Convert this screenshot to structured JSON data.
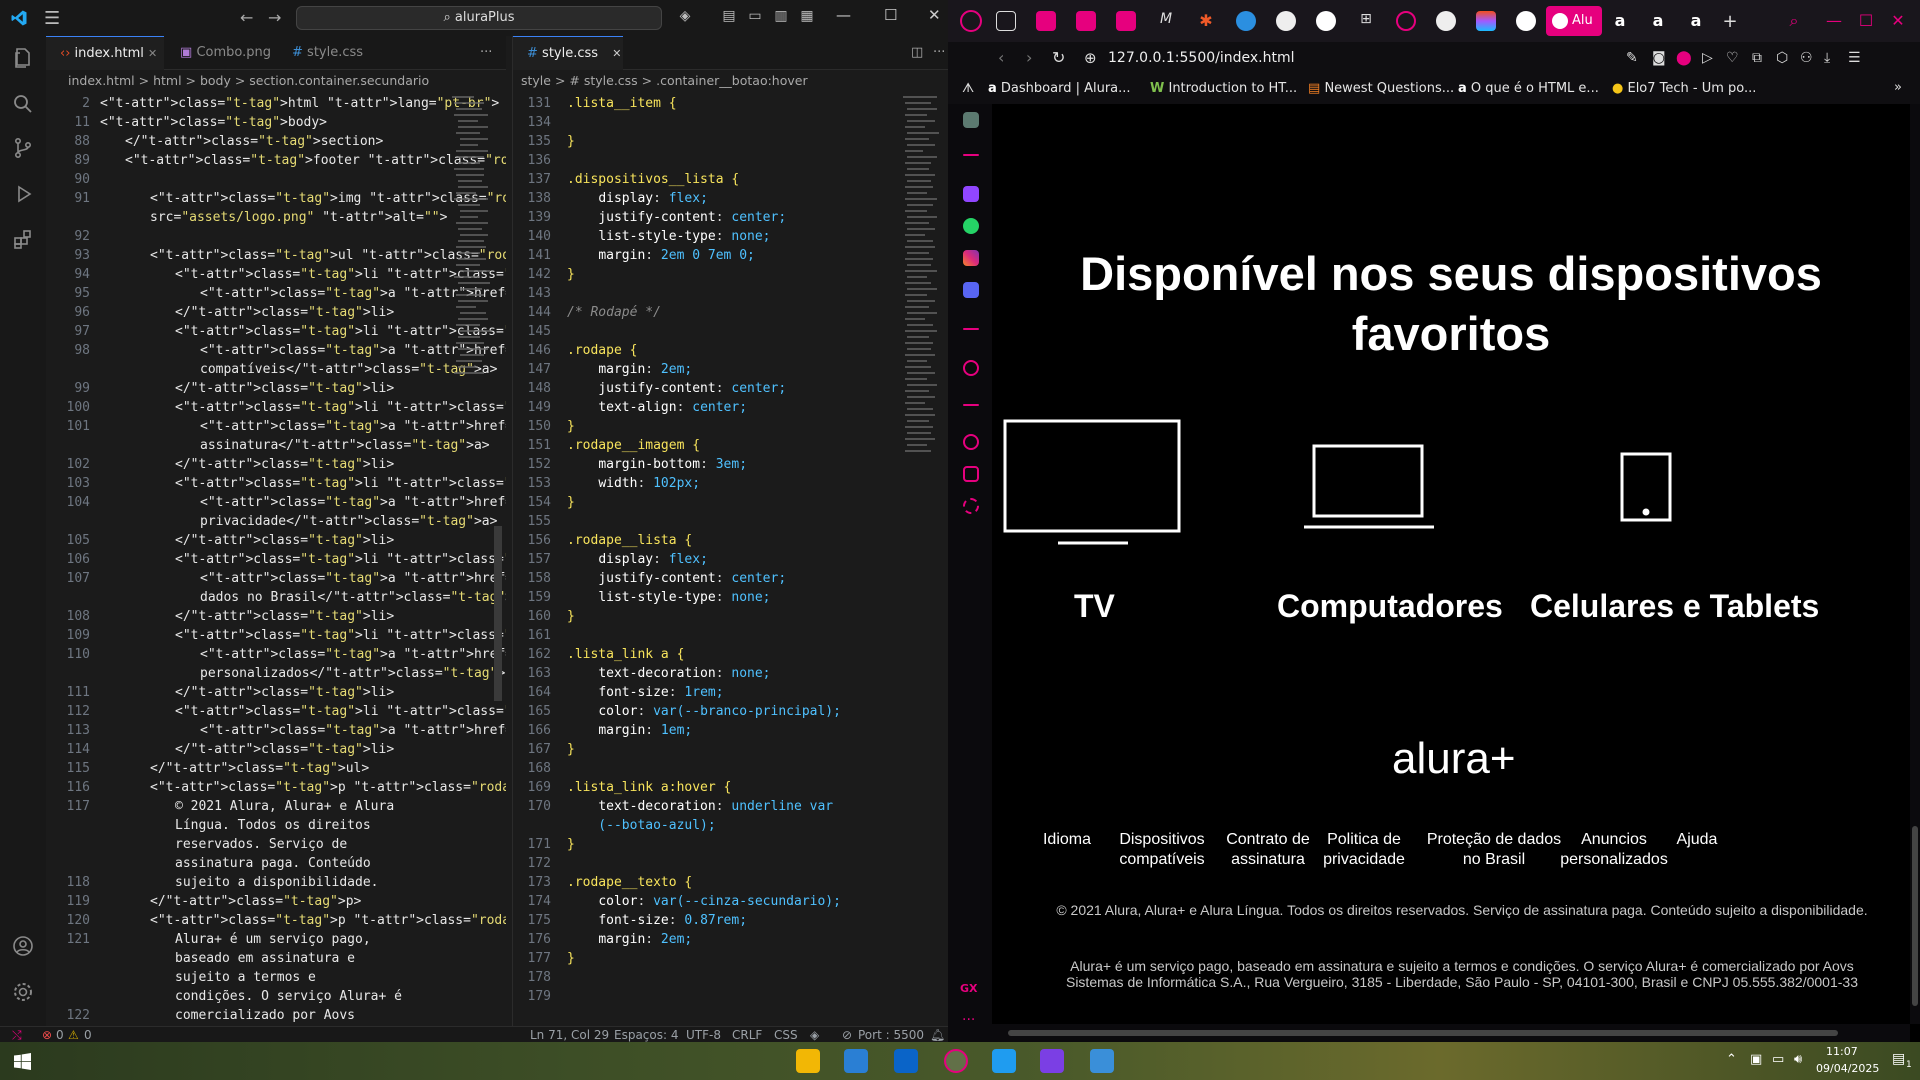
{
  "vscode": {
    "command_center": "aluraPlus",
    "tabs": [
      "index.html",
      "Combo.png",
      "style.css"
    ],
    "right_tab": "style.css",
    "left_crumbs": "index.html  >  html  >  body  >  section.container.secundario",
    "right_crumbs": "style  >  # style.css  >  .container__botao:hover",
    "status": {
      "errors": "0",
      "warnings": "0",
      "position": "Ln 71, Col 29",
      "spaces": "Espaços: 4",
      "encoding": "UTF-8",
      "eol": "CRLF",
      "language": "CSS",
      "port": "Port : 5500"
    },
    "left_lines": [
      {
        "n": "2",
        "t": "<html lang=\"pt-br\">",
        "i": 0
      },
      {
        "n": "11",
        "t": "<body>",
        "i": 0
      },
      {
        "n": "88",
        "t": "</section>",
        "i": 1
      },
      {
        "n": "89",
        "t": "<footer class=\"rodape\">",
        "i": 1
      },
      {
        "n": "90",
        "t": "",
        "i": 0
      },
      {
        "n": "91",
        "t": "<img class=\"rodape__imagem\"",
        "i": 2
      },
      {
        "n": "",
        "t": "src=\"assets/logo.png\" alt=\"\">",
        "i": 2
      },
      {
        "n": "92",
        "t": "",
        "i": 0
      },
      {
        "n": "93",
        "t": "<ul class=\"rodape__lista\">",
        "i": 2
      },
      {
        "n": "94",
        "t": "<li class=\"lista_link\">",
        "i": 3
      },
      {
        "n": "95",
        "t": "<a href=\"#\">Idioma</a>",
        "i": 4
      },
      {
        "n": "96",
        "t": "</li>",
        "i": 3
      },
      {
        "n": "97",
        "t": "<li class=\"lista_link\">",
        "i": 3
      },
      {
        "n": "98",
        "t": "<a href=\"#\">Dispositivos",
        "i": 4
      },
      {
        "n": "",
        "t": "compatíveis</a>",
        "i": 4
      },
      {
        "n": "99",
        "t": "</li>",
        "i": 3
      },
      {
        "n": "100",
        "t": "<li class=\"lista_link\">",
        "i": 3
      },
      {
        "n": "101",
        "t": "<a href=\"#\">Contrato de",
        "i": 4
      },
      {
        "n": "",
        "t": "assinatura</a>",
        "i": 4
      },
      {
        "n": "102",
        "t": "</li>",
        "i": 3
      },
      {
        "n": "103",
        "t": "<li class=\"lista_link\">",
        "i": 3
      },
      {
        "n": "104",
        "t": "<a href=\"#\">Politica de",
        "i": 4
      },
      {
        "n": "",
        "t": "privacidade</a>",
        "i": 4
      },
      {
        "n": "105",
        "t": "</li>",
        "i": 3
      },
      {
        "n": "106",
        "t": "<li class=\"lista_link\">",
        "i": 3
      },
      {
        "n": "107",
        "t": "<a href=\"#\">Proteção de",
        "i": 4
      },
      {
        "n": "",
        "t": "dados no Brasil</a>",
        "i": 4
      },
      {
        "n": "108",
        "t": "</li>",
        "i": 3
      },
      {
        "n": "109",
        "t": "<li class=\"lista_link\">",
        "i": 3
      },
      {
        "n": "110",
        "t": "<a href=\"#\">Anuncios",
        "i": 4
      },
      {
        "n": "",
        "t": "personalizados</a>",
        "i": 4
      },
      {
        "n": "111",
        "t": "</li>",
        "i": 3
      },
      {
        "n": "112",
        "t": "<li class=\"lista_link\">",
        "i": 3
      },
      {
        "n": "113",
        "t": "<a href=\"#\">Ajuda</a>",
        "i": 4
      },
      {
        "n": "114",
        "t": "</li>",
        "i": 3
      },
      {
        "n": "115",
        "t": "</ul>",
        "i": 2
      },
      {
        "n": "116",
        "t": "<p class=\"rodape__texto\">",
        "i": 2
      },
      {
        "n": "117",
        "t": "© 2021 Alura, Alura+ e Alura",
        "i": 3
      },
      {
        "n": "",
        "t": "Língua. Todos os direitos",
        "i": 3
      },
      {
        "n": "",
        "t": "reservados. Serviço de",
        "i": 3
      },
      {
        "n": "",
        "t": "assinatura paga. Conteúdo",
        "i": 3
      },
      {
        "n": "118",
        "t": "sujeito a disponibilidade.",
        "i": 3
      },
      {
        "n": "119",
        "t": "</p>",
        "i": 2
      },
      {
        "n": "120",
        "t": "<p class=\"rodape__texto\">",
        "i": 2
      },
      {
        "n": "121",
        "t": "Alura+ é um serviço pago,",
        "i": 3
      },
      {
        "n": "",
        "t": "baseado em assinatura e",
        "i": 3
      },
      {
        "n": "",
        "t": "sujeito a termos e",
        "i": 3
      },
      {
        "n": "",
        "t": "condições. O serviço Alura+ é",
        "i": 3
      },
      {
        "n": "122",
        "t": "comercializado por Aovs",
        "i": 3
      }
    ],
    "right_lines": [
      {
        "n": "131",
        "t": ".lista__item {",
        "k": "sel"
      },
      {
        "n": "134",
        "t": "",
        "k": ""
      },
      {
        "n": "135",
        "t": "}",
        "k": "sel"
      },
      {
        "n": "136",
        "t": "",
        "k": ""
      },
      {
        "n": "137",
        "t": ".dispositivos__lista {",
        "k": "sel"
      },
      {
        "n": "138",
        "t": "    display: flex;",
        "k": "prop"
      },
      {
        "n": "139",
        "t": "    justify-content: center;",
        "k": "prop"
      },
      {
        "n": "140",
        "t": "    list-style-type: none;",
        "k": "prop"
      },
      {
        "n": "141",
        "t": "    margin: 2em 0 7em 0;",
        "k": "prop"
      },
      {
        "n": "142",
        "t": "}",
        "k": "sel"
      },
      {
        "n": "143",
        "t": "",
        "k": ""
      },
      {
        "n": "144",
        "t": "/* Rodapé */",
        "k": "cmt"
      },
      {
        "n": "145",
        "t": "",
        "k": ""
      },
      {
        "n": "146",
        "t": ".rodape {",
        "k": "sel"
      },
      {
        "n": "147",
        "t": "    margin: 2em;",
        "k": "prop"
      },
      {
        "n": "148",
        "t": "    justify-content: center;",
        "k": "prop"
      },
      {
        "n": "149",
        "t": "    text-align: center;",
        "k": "prop"
      },
      {
        "n": "150",
        "t": "}",
        "k": "sel"
      },
      {
        "n": "151",
        "t": ".rodape__imagem {",
        "k": "sel"
      },
      {
        "n": "152",
        "t": "    margin-bottom: 3em;",
        "k": "prop"
      },
      {
        "n": "153",
        "t": "    width: 102px;",
        "k": "prop"
      },
      {
        "n": "154",
        "t": "}",
        "k": "sel"
      },
      {
        "n": "155",
        "t": "",
        "k": ""
      },
      {
        "n": "156",
        "t": ".rodape__lista {",
        "k": "sel"
      },
      {
        "n": "157",
        "t": "    display: flex;",
        "k": "prop"
      },
      {
        "n": "158",
        "t": "    justify-content: center;",
        "k": "prop"
      },
      {
        "n": "159",
        "t": "    list-style-type: none;",
        "k": "prop"
      },
      {
        "n": "160",
        "t": "}",
        "k": "sel"
      },
      {
        "n": "161",
        "t": "",
        "k": ""
      },
      {
        "n": "162",
        "t": ".lista_link a {",
        "k": "sel"
      },
      {
        "n": "163",
        "t": "    text-decoration: none;",
        "k": "prop"
      },
      {
        "n": "164",
        "t": "    font-size: 1rem;",
        "k": "prop"
      },
      {
        "n": "165",
        "t": "    color: var(--branco-principal);",
        "k": "prop"
      },
      {
        "n": "166",
        "t": "    margin: 1em;",
        "k": "prop"
      },
      {
        "n": "167",
        "t": "}",
        "k": "sel"
      },
      {
        "n": "168",
        "t": "",
        "k": ""
      },
      {
        "n": "169",
        "t": ".lista_link a:hover {",
        "k": "sel"
      },
      {
        "n": "170",
        "t": "    text-decoration: underline var",
        "k": "prop"
      },
      {
        "n": "",
        "t": "    (--botao-azul);",
        "k": "prop"
      },
      {
        "n": "171",
        "t": "}",
        "k": "sel"
      },
      {
        "n": "172",
        "t": "",
        "k": ""
      },
      {
        "n": "173",
        "t": ".rodape__texto {",
        "k": "sel"
      },
      {
        "n": "174",
        "t": "    color: var(--cinza-secundario);",
        "k": "prop"
      },
      {
        "n": "175",
        "t": "    font-size: 0.87rem;",
        "k": "prop"
      },
      {
        "n": "176",
        "t": "    margin: 2em;",
        "k": "prop"
      },
      {
        "n": "177",
        "t": "}",
        "k": "sel"
      },
      {
        "n": "178",
        "t": "",
        "k": ""
      },
      {
        "n": "179",
        "t": "",
        "k": ""
      }
    ]
  },
  "browser": {
    "active_tab_label": "Alu",
    "url": "127.0.0.1:5500/index.html",
    "bookmarks": [
      "Dashboard | Alura...",
      "Introduction to HT...",
      "Newest Questions...",
      "O que é o HTML e...",
      "Elo7 Tech - Um po..."
    ],
    "page": {
      "heading": "Disponível nos seus dispositivos favoritos",
      "devices": [
        "TV",
        "Computadores",
        "Celulares e Tablets"
      ],
      "logo_text": "alura+",
      "footer_links": [
        "Idioma",
        "Dispositivos compatíveis",
        "Contrato de assinatura",
        "Politica de privacidade",
        "Proteção de dados no Brasil",
        "Anuncios personalizados",
        "Ajuda"
      ],
      "footer_text_1": "© 2021 Alura, Alura+ e Alura Língua. Todos os direitos reservados. Serviço de assinatura paga. Conteúdo sujeito a disponibilidade.",
      "footer_text_2": "Alura+ é um serviço pago, baseado em assinatura e sujeito a termos e condições. O serviço Alura+ é comercializado por Aovs Sistemas de Informática S.A., Rua Vergueiro, 3185 - Liberdade, São Paulo - SP, 04101-300, Brasil e CNPJ 05.555.382/0001-33"
    }
  },
  "taskbar": {
    "time": "11:07",
    "date": "09/04/2025",
    "notification_count": "1"
  },
  "colors": {
    "accent_pink": "#e6007e",
    "page_bg": "#000000",
    "text_white": "#ffffff"
  }
}
